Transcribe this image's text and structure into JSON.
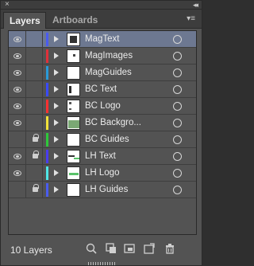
{
  "window": {
    "close_glyph": "×",
    "collapse_glyph": "◂◂"
  },
  "tabs": [
    {
      "label": "Layers",
      "active": true
    },
    {
      "label": "Artboards",
      "active": false
    }
  ],
  "tab_menu_glyph": "▾≡",
  "layers": [
    {
      "name": "MagText",
      "visible": true,
      "locked": false,
      "color": "#4a5cf0",
      "selected": true
    },
    {
      "name": "MagImages",
      "visible": true,
      "locked": false,
      "color": "#e0303a",
      "selected": false
    },
    {
      "name": "MagGuides",
      "visible": true,
      "locked": false,
      "color": "#2a9ad8",
      "selected": false
    },
    {
      "name": "BC Text",
      "visible": true,
      "locked": false,
      "color": "#3a4bff",
      "selected": false
    },
    {
      "name": "BC Logo",
      "visible": true,
      "locked": false,
      "color": "#ff3030",
      "selected": false
    },
    {
      "name": "BC Backgro...",
      "visible": true,
      "locked": false,
      "color": "#f2e23a",
      "selected": false
    },
    {
      "name": "BC Guides",
      "visible": false,
      "locked": true,
      "color": "#2ec83a",
      "selected": false
    },
    {
      "name": "LH Text",
      "visible": true,
      "locked": true,
      "color": "#4a3cf0",
      "selected": false
    },
    {
      "name": "LH Logo",
      "visible": true,
      "locked": false,
      "color": "#4fe6e6",
      "selected": false
    },
    {
      "name": "LH Guides",
      "visible": false,
      "locked": true,
      "color": "#4a5cf0",
      "selected": false
    }
  ],
  "footer": {
    "layer_count": "10 Layers"
  }
}
